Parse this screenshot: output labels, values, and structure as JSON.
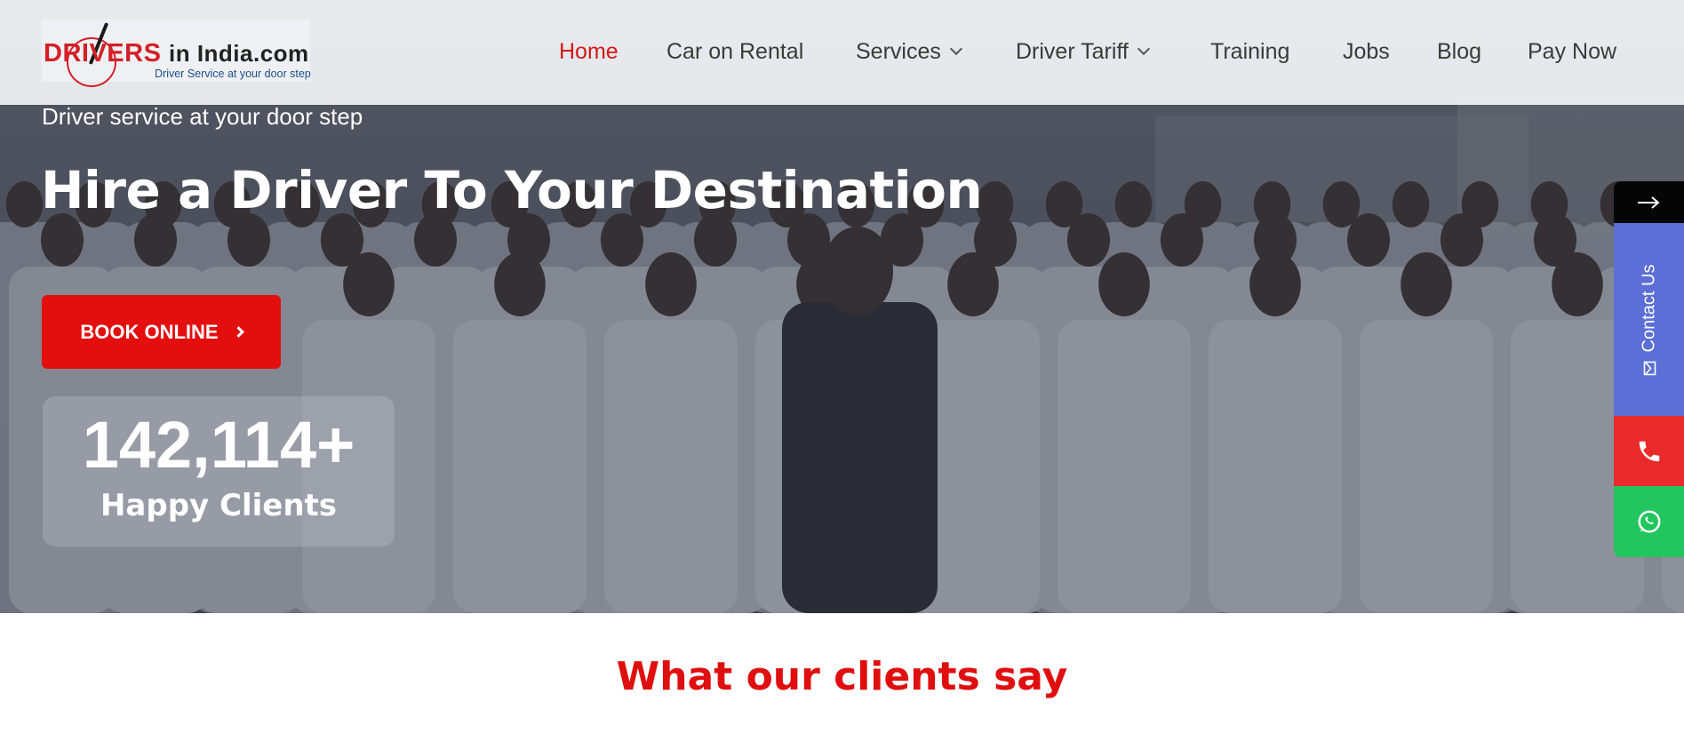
{
  "header": {
    "logo": {
      "brand_red": "DRIVERS",
      "brand_dark": "in India.com",
      "tagline": "Driver Service at your door step"
    },
    "nav": [
      {
        "label": "Home",
        "active": true,
        "dropdown": false
      },
      {
        "label": "Car on Rental",
        "active": false,
        "dropdown": false
      },
      {
        "label": "Services",
        "active": false,
        "dropdown": true
      },
      {
        "label": "Driver Tariff",
        "active": false,
        "dropdown": true
      },
      {
        "label": "Training",
        "active": false,
        "dropdown": false
      },
      {
        "label": "Jobs",
        "active": false,
        "dropdown": false
      },
      {
        "label": "Blog",
        "active": false,
        "dropdown": false
      },
      {
        "label": "Pay Now",
        "active": false,
        "dropdown": false
      }
    ]
  },
  "hero": {
    "tagline": "Driver service at your door step",
    "headline": "Hire a Driver To Your Destination",
    "cta_label": "BOOK ONLINE",
    "stat_value": "142,114+",
    "stat_label": "Happy Clients"
  },
  "side_widget": {
    "arrow_icon": "arrow-right-icon",
    "contact_label": "Contact Us",
    "phone_icon": "phone-icon",
    "whatsapp_icon": "whatsapp-icon"
  },
  "testimonials": {
    "title": "What our clients say"
  },
  "colors": {
    "brand_red": "#d32027",
    "cta_red": "#e30f0f",
    "nav_active": "#d11a1a",
    "contact_blue": "#5b6fd6",
    "phone_red": "#ea2a2a",
    "whatsapp_green": "#22c55e"
  }
}
